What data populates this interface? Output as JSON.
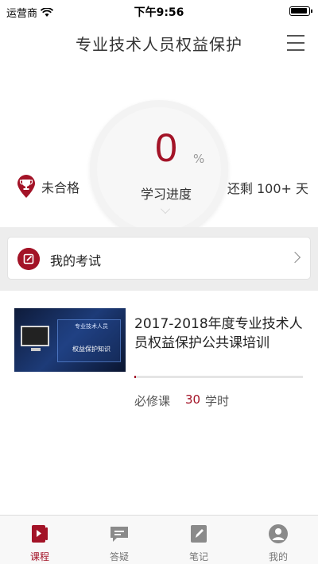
{
  "status_bar": {
    "carrier": "运营商",
    "time": "下午9:56"
  },
  "header": {
    "title": "专业技术人员权益保护"
  },
  "progress": {
    "value": "0",
    "unit": "%",
    "label": "学习进度",
    "status": "未合格",
    "remaining": "还剩 100+ 天"
  },
  "exam": {
    "label": "我的考试"
  },
  "course": {
    "title": "2017-2018年度专业技术人员权益保护公共课培训",
    "thumbnail_line1": "专业技术人员",
    "thumbnail_line2": "权益保护知识",
    "type": "必修课",
    "hours": "30",
    "hours_unit": "学时",
    "progress_fraction": 0.01
  },
  "tabs": [
    {
      "label": "课程",
      "icon": "course-icon",
      "active": true
    },
    {
      "label": "答疑",
      "icon": "chat-icon",
      "active": false
    },
    {
      "label": "笔记",
      "icon": "note-icon",
      "active": false
    },
    {
      "label": "我的",
      "icon": "user-icon",
      "active": false
    }
  ],
  "colors": {
    "accent": "#a31327",
    "tab_inactive": "#777777"
  }
}
